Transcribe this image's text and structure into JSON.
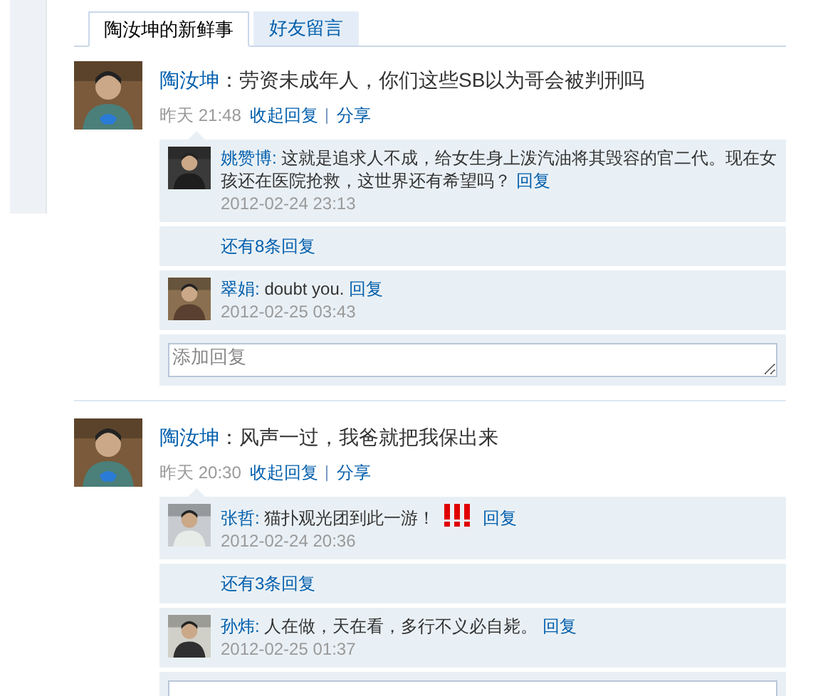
{
  "tabs": [
    {
      "label": "陶汝坤的新鲜事",
      "selected": true
    },
    {
      "label": "好友留言",
      "selected": false
    }
  ],
  "posts": [
    {
      "author": "陶汝坤",
      "text": "：劳资未成年人，你们这些SB以为哥会被判刑吗",
      "day": "昨天",
      "time": "21:48",
      "actions": [
        "收起回复",
        "分享"
      ],
      "replies": [
        {
          "kind": "reply",
          "author": "姚赞博:",
          "text": "这就是追求人不成，给女生身上泼汽油将其毁容的官二代。现在女孩还在医院抢救，这世界还有希望吗？",
          "emoticon": false,
          "reply_link": "回复",
          "time": "2012-02-24 23:13"
        },
        {
          "kind": "more",
          "text": "还有8条回复"
        },
        {
          "kind": "reply",
          "author": "翠娟:",
          "text": "doubt you.",
          "emoticon": false,
          "reply_link": "回复",
          "time": "2012-02-25 03:43"
        }
      ],
      "reply_field": true,
      "reply_placeholder": "添加回复"
    },
    {
      "author": "陶汝坤",
      "text": "：风声一过，我爸就把我保出来",
      "day": "昨天",
      "time": "20:30",
      "actions": [
        "收起回复",
        "分享"
      ],
      "replies": [
        {
          "kind": "reply",
          "author": "张哲:",
          "text": "猫扑观光团到此一游！",
          "emoticon": true,
          "reply_link": "回复",
          "time": "2012-02-24 20:36"
        },
        {
          "kind": "more",
          "text": "还有3条回复"
        },
        {
          "kind": "reply",
          "author": "孙炜:",
          "text": "人在做，天在看，多行不义必自毙。",
          "emoticon": false,
          "reply_link": "回复",
          "time": "2012-02-25 01:37"
        }
      ],
      "reply_field": true
    }
  ]
}
